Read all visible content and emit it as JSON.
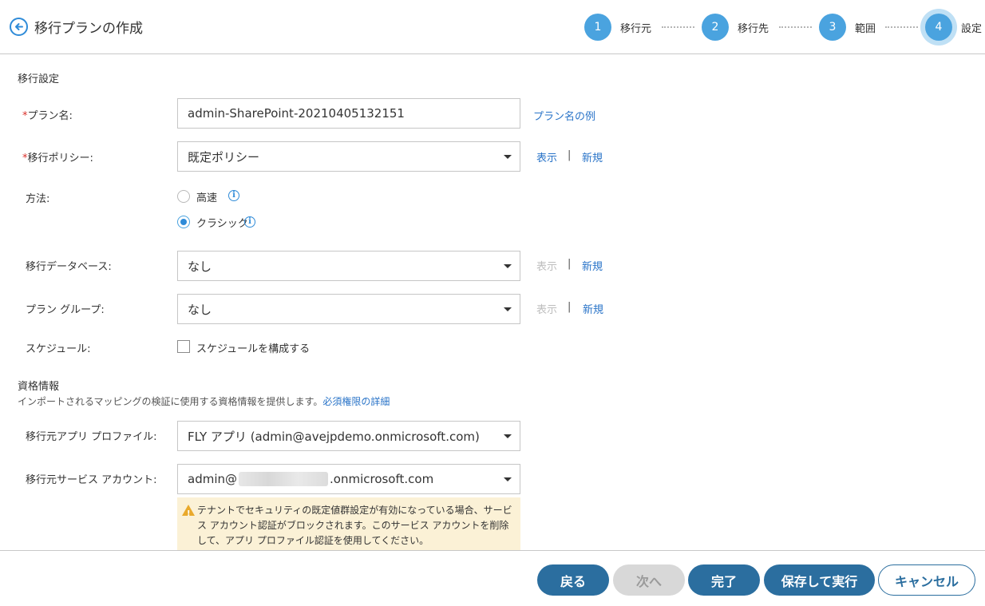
{
  "header": {
    "title": "移行プランの作成",
    "steps": [
      {
        "number": "1",
        "label": "移行元"
      },
      {
        "number": "2",
        "label": "移行先"
      },
      {
        "number": "3",
        "label": "範囲"
      },
      {
        "number": "4",
        "label": "設定",
        "active": true
      }
    ]
  },
  "migration_settings": {
    "section_title": "移行設定",
    "plan_name": {
      "required_mark": "*",
      "label": "プラン名:",
      "value": "admin-SharePoint-20210405132151",
      "example_link": "プラン名の例"
    },
    "policy": {
      "required_mark": "*",
      "label": "移行ポリシー:",
      "value": "既定ポリシー",
      "show_link": "表示",
      "separator": "|",
      "new_link": "新規"
    },
    "method": {
      "label": "方法:",
      "options": [
        {
          "label": "高速",
          "checked": false
        },
        {
          "label": "クラシック",
          "checked": true
        }
      ]
    },
    "database": {
      "label": "移行データベース:",
      "value": "なし",
      "show_link": "表示",
      "separator": "|",
      "new_link": "新規"
    },
    "plan_group": {
      "label": "プラン グループ:",
      "value": "なし",
      "show_link": "表示",
      "separator": "|",
      "new_link": "新規"
    },
    "schedule": {
      "label": "スケジュール:",
      "checkbox_label": "スケジュールを構成する",
      "checked": false
    }
  },
  "credentials": {
    "section_title": "資格情報",
    "description": "インポートされるマッピングの検証に使用する資格情報を提供します。",
    "details_link": "必須権限の詳細",
    "app_profile": {
      "label": "移行元アプリ プロファイル:",
      "value": "FLY アプリ (admin@avejpdemo.onmicrosoft.com)"
    },
    "service_account": {
      "label": "移行元サービス アカウント:",
      "value_prefix": "admin@",
      "value_suffix": ".onmicrosoft.com"
    },
    "warning": "テナントでセキュリティの既定値群設定が有効になっている場合、サービス アカウント認証がブロックされます。このサービス アカウントを削除して、アプリ プロファイル認証を使用してください。"
  },
  "footer": {
    "back": "戻る",
    "next": "次へ",
    "finish": "完了",
    "save_run": "保存して実行",
    "cancel": "キャンセル"
  },
  "colors": {
    "accent": "#4aa3df",
    "primary_button": "#2b6e9f",
    "link": "#2a74c8",
    "required": "#d9302b",
    "warning_bg": "#fbf1d6"
  }
}
